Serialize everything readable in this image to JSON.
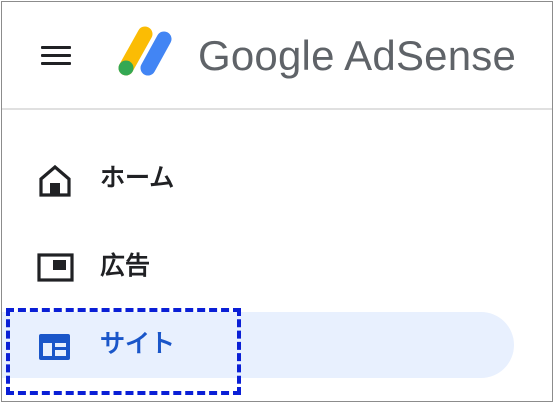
{
  "header": {
    "menu_icon": "hamburger-menu-icon",
    "logo_icon": "adsense-logo-icon",
    "logo_text": "Google AdSense",
    "logo_colors": {
      "yellow": "#FBBC04",
      "blue": "#4285F4",
      "green": "#34A853",
      "text": "#5F6368"
    }
  },
  "sidebar": {
    "items": [
      {
        "label": "ホーム",
        "icon": "home-icon",
        "active": false
      },
      {
        "label": "広告",
        "icon": "ads-icon",
        "active": false
      },
      {
        "label": "サイト",
        "icon": "sites-icon",
        "active": true
      }
    ],
    "active_color": "#1A56C9",
    "active_bg": "#E8F0FE"
  },
  "annotation": {
    "highlight_color": "#0A1FD6",
    "style": "dashed"
  }
}
